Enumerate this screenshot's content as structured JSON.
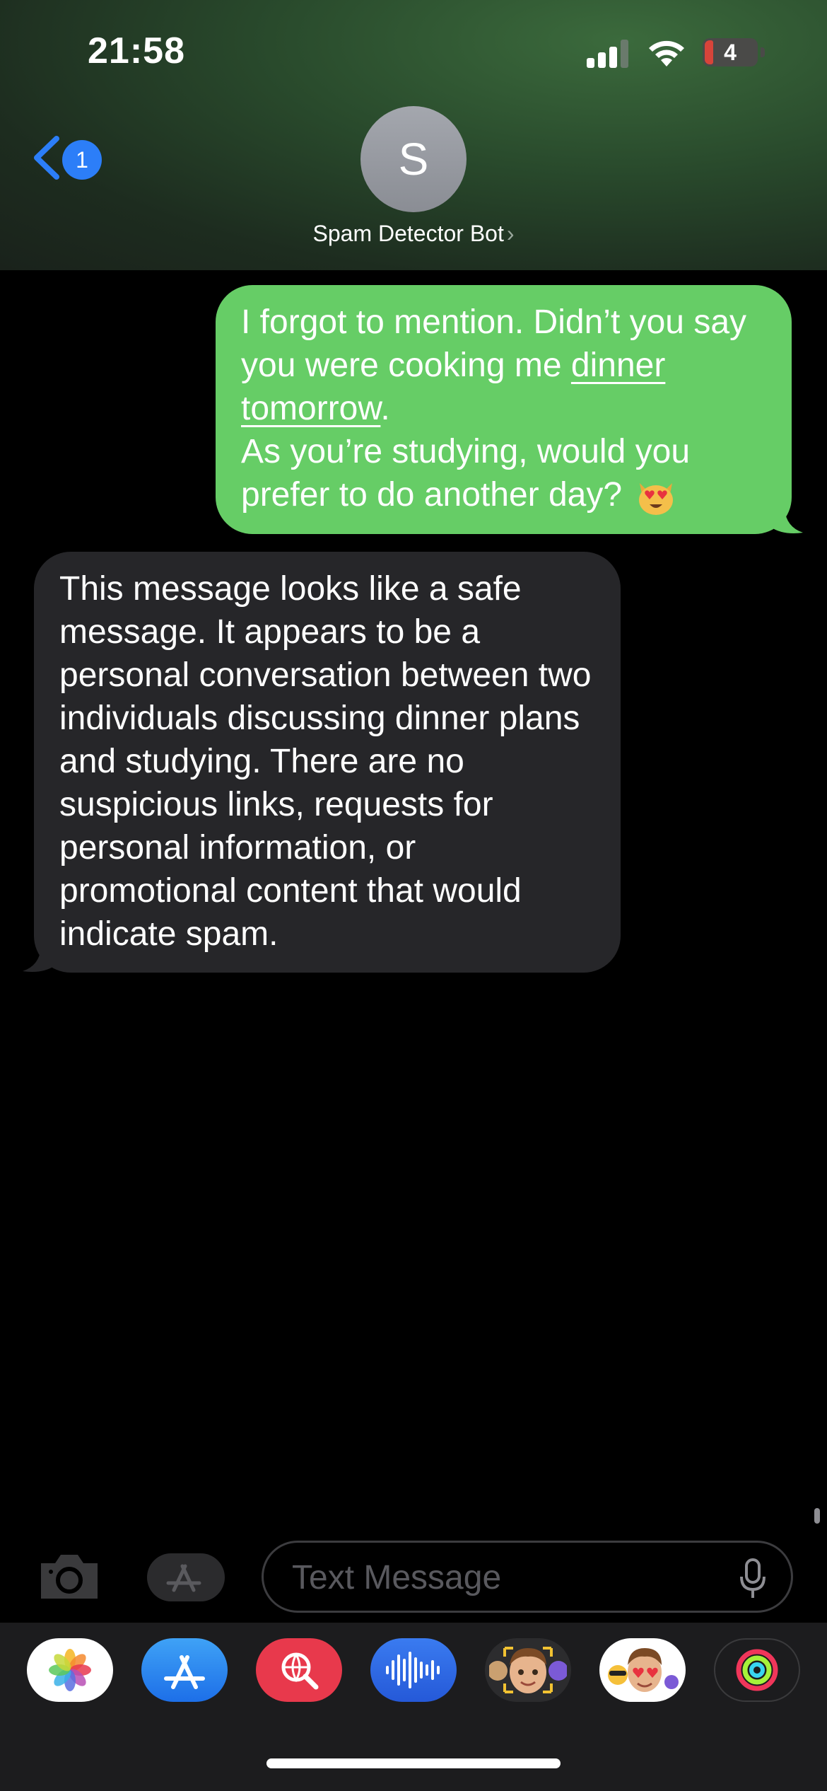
{
  "status_bar": {
    "time": "21:58",
    "battery": "4"
  },
  "header": {
    "back_badge": "1",
    "avatar_initial": "S",
    "contact_name": "Spam Detector Bot",
    "chevron": "›"
  },
  "messages": {
    "outgoing": {
      "line1": "I forgot to mention. Didn’t you say you were cooking me ",
      "link": "dinner tomorrow",
      "after_link": ".",
      "line2": "As you’re studying, would you prefer to do another day?"
    },
    "incoming": {
      "text": "This message looks like a safe message. It appears to be a personal conversation between two individuals discussing dinner plans and studying. There are no suspicious links, requests for personal information, or promotional content that would indicate spam."
    }
  },
  "composer": {
    "placeholder": "Text Message"
  },
  "drawer_apps": [
    "photos",
    "app-store",
    "image-search",
    "audio-messages",
    "memoji",
    "memoji-stickers",
    "activity"
  ],
  "colors": {
    "outgoing_bubble": "#66cd66",
    "incoming_bubble": "#262629",
    "accent": "#2c7ef8",
    "background": "#000000"
  }
}
